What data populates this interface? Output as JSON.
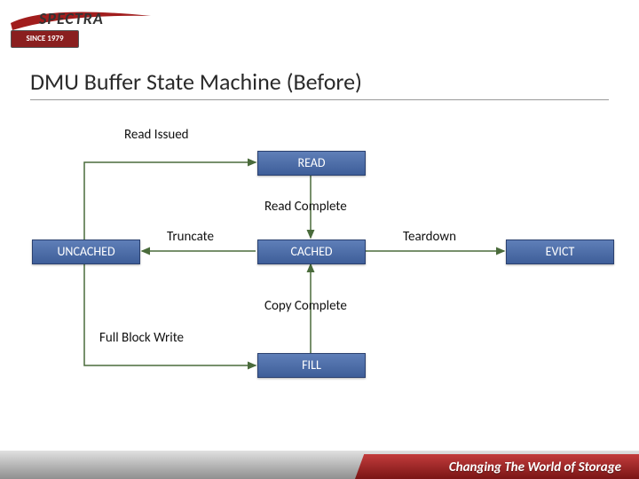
{
  "logo": {
    "brand": "SPECTRA",
    "badge": "SINCE 1979"
  },
  "title": "DMU Buffer State Machine (Before)",
  "states": {
    "read": "READ",
    "uncached": "UNCACHED",
    "cached": "CACHED",
    "evict": "EVICT",
    "fill": "FILL"
  },
  "labels": {
    "read_issued": "Read Issued",
    "read_complete": "Read Complete",
    "truncate": "Truncate",
    "teardown": "Teardown",
    "copy_complete": "Copy Complete",
    "full_block_write": "Full Block Write"
  },
  "footer": {
    "tagline": "Changing The World of Storage"
  }
}
